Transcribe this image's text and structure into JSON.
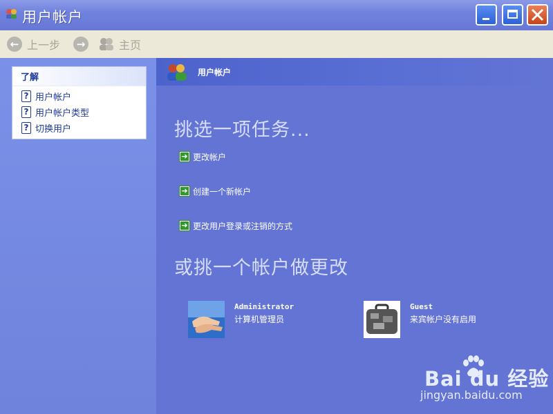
{
  "window": {
    "title": "用户帐户"
  },
  "toolbar": {
    "back_label": "上一步",
    "home_label": "主页"
  },
  "sidebar": {
    "header": "了解",
    "items": [
      {
        "label": "用户帐户"
      },
      {
        "label": "用户帐户类型"
      },
      {
        "label": "切换用户"
      }
    ]
  },
  "main": {
    "header_title": "用户帐户",
    "pick_task_heading": "挑选一项任务...",
    "tasks": [
      {
        "label": "更改帐户"
      },
      {
        "label": "创建一个新帐户"
      },
      {
        "label": "更改用户登录或注销的方式"
      }
    ],
    "pick_account_heading": "或挑一个帐户做更改",
    "accounts": [
      {
        "name": "Administrator",
        "description": "计算机管理员"
      },
      {
        "name": "Guest",
        "description": "来宾帐户没有启用"
      }
    ]
  },
  "watermark": {
    "logo": "Bai du 经验",
    "url": "jingyan.baidu.com"
  }
}
